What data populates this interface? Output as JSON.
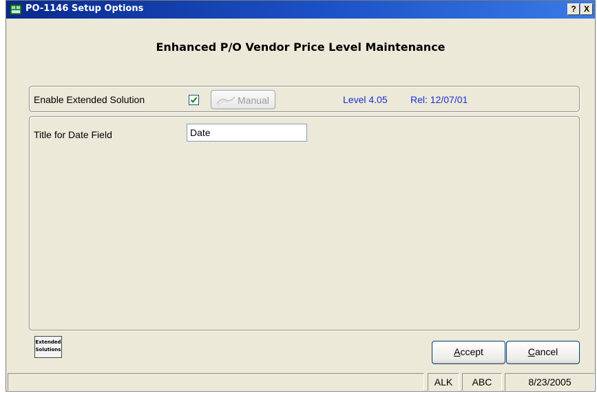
{
  "window": {
    "title": "PO-1146 Setup Options",
    "help_glyph": "?",
    "close_glyph": "X"
  },
  "heading": "Enhanced P/O Vendor Price Level Maintenance",
  "extended": {
    "label": "Enable Extended Solution",
    "checked": true,
    "manual_label": "Manual",
    "level": "Level 4.05",
    "release": "Rel: 12/07/01"
  },
  "date_field": {
    "label": "Title for Date Field",
    "value": "Date"
  },
  "logo": {
    "line1": "Extended",
    "line2": "Solutions"
  },
  "buttons": {
    "accept": {
      "underline": "A",
      "rest": "ccept"
    },
    "cancel": {
      "underline": "C",
      "rest": "ancel"
    }
  },
  "statusbar": {
    "user": "ALK",
    "company": "ABC",
    "date": "8/23/2005"
  },
  "colors": {
    "title_bar": "#0a2a8c",
    "info_text": "#1a2ed8",
    "check_mark": "#1e8a1e"
  }
}
